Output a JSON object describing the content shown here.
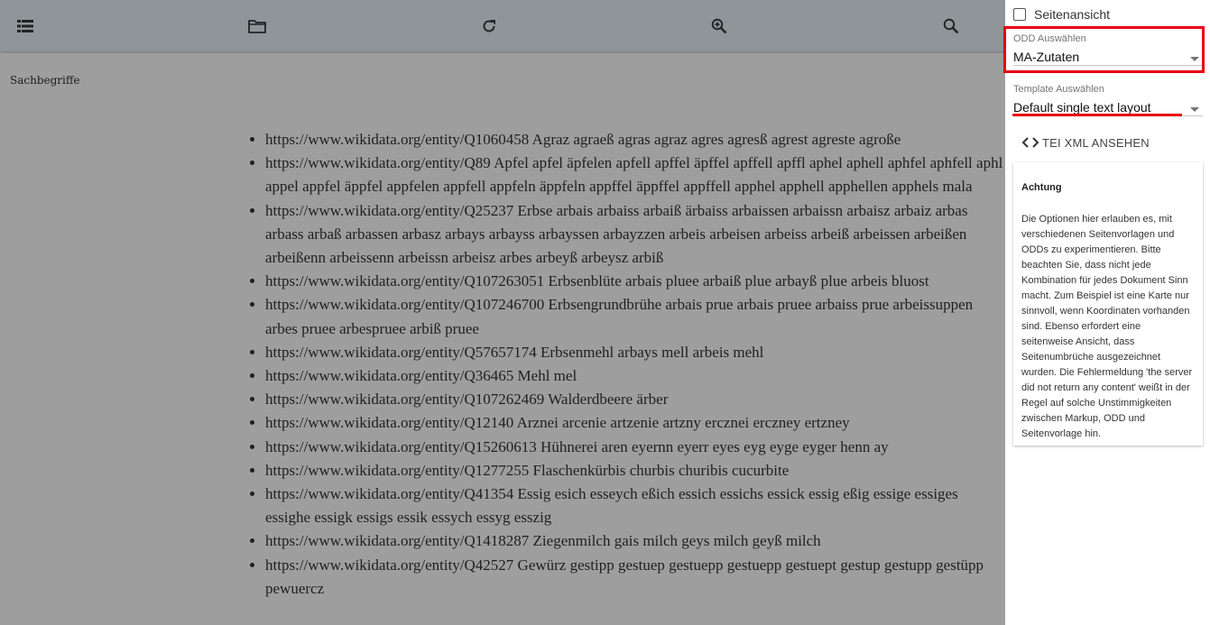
{
  "toolbar": {
    "buttons": [
      {
        "name": "menu-list-icon",
        "label": "Inhalt"
      },
      {
        "name": "folder-icon",
        "label": "Dokumente"
      },
      {
        "name": "reload-icon",
        "label": "Neu laden"
      },
      {
        "name": "zoom-in-icon",
        "label": "Vergrößern"
      },
      {
        "name": "search-icon",
        "label": "Suchen"
      }
    ]
  },
  "main": {
    "section_title": "Sachbegriffe",
    "terms": [
      "https://www.wikidata.org/entity/Q1060458 Agraz agraeß agras agraz agres agresß agrest agreste agroße",
      "https://www.wikidata.org/entity/Q89 Apfel apfel äpfelen apfell apffel äpffel apffell apffl aphel aphell aphfel aphfell aphl appel appfel äppfel appfelen appfell appfeln äppfeln appffel äppffel appffell apphel apphell apphellen apphels mala",
      "https://www.wikidata.org/entity/Q25237 Erbse arbais arbaiss arbaiß ärbaiss arbaissen arbaissn arbaisz arbaiz arbas arbass arbaß arbassen arbasz arbays arbayss arbayssen arbayzzen arbeis arbeisen arbeiss arbeiß arbeissen arbeißen arbeißenn arbeissenn arbeissn arbeisz arbes arbeyß arbeysz arbiß",
      "https://www.wikidata.org/entity/Q107263051 Erbsenblüte arbais pluee arbaiß plue arbayß plue arbeis bluost",
      "https://www.wikidata.org/entity/Q107246700 Erbsengrundbrühe arbais prue arbais pruee arbaiss prue arbeissuppen arbes pruee arbespruee arbiß pruee",
      "https://www.wikidata.org/entity/Q57657174 Erbsenmehl arbays mell arbeis mehl",
      "https://www.wikidata.org/entity/Q36465 Mehl mel",
      "https://www.wikidata.org/entity/Q107262469 Walderdbeere ärber",
      "https://www.wikidata.org/entity/Q12140 Arznei arcenie artzenie artzny ercznei erczney ertzney",
      "https://www.wikidata.org/entity/Q15260613 Hühnerei aren eyernn eyerr eyes eyg eyge eyger henn ay",
      "https://www.wikidata.org/entity/Q1277255 Flaschenkürbis churbis churibis cucurbite",
      "https://www.wikidata.org/entity/Q41354 Essig esich esseych eßich essich essichs essick essig eßig essige essiges essighe essigk essigs essik essych essyg esszig",
      "https://www.wikidata.org/entity/Q1418287 Ziegenmilch gais milch geys milch geyß milch",
      "https://www.wikidata.org/entity/Q42527 Gewürz gestipp gestuep gestuepp gestuepp gestuept gestup gestupp gestüpp pewuercz"
    ]
  },
  "sidebar": {
    "page_view_label": "Seitenansicht",
    "page_view_checked": false,
    "odd": {
      "label": "ODD Auswählen",
      "value": "MA-Zutaten"
    },
    "template": {
      "label": "Template Auswählen",
      "value": "Default single text layout"
    },
    "xml_button": "TEI XML ANSEHEN",
    "notice": {
      "title": "Achtung",
      "body": "Die Optionen hier erlauben es, mit verschiedenen Seitenvorlagen und ODDs zu experimentieren. Bitte beachten Sie, dass nicht jede Kombination für jedes Dokument Sinn macht. Zum Beispiel ist eine Karte nur sinnvoll, wenn Koordinaten vorhanden sind. Ebenso erfordert eine seitenweise Ansicht, dass Seitenumbrüche ausgezeichnet wurden. Die Fehlermeldung 'the server did not return any content' weißt in der Regel auf solche Unstimmigkeiten zwischen Markup, ODD und Seitenvorlage hin."
    }
  },
  "colors": {
    "highlight": "#e8000e",
    "toolbar_bg": "#8e969a",
    "content_bg": "#9e9e9e",
    "sidebar_bg": "#ffffff"
  }
}
